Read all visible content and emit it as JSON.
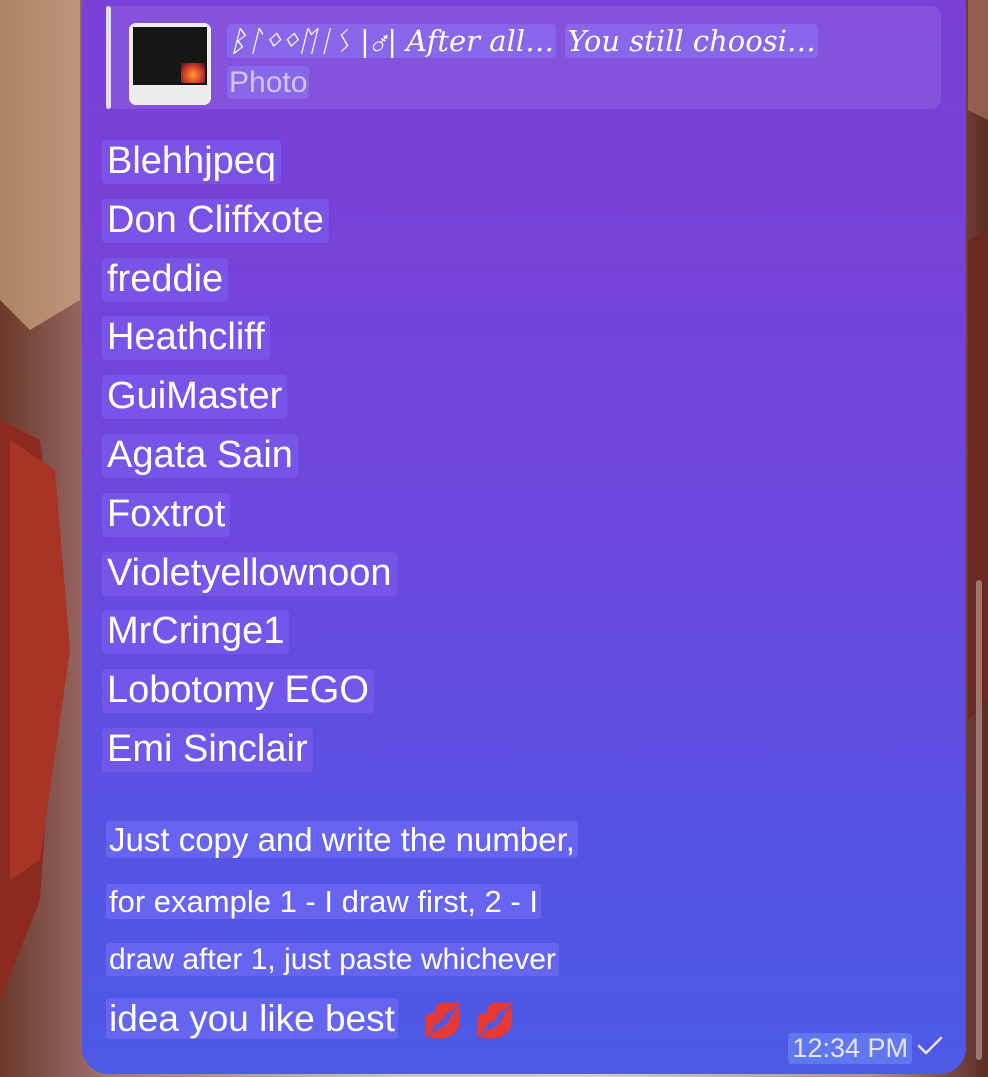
{
  "reply": {
    "name_label": "ᛒᛚᛜᛜᛖᛁᛊ |⚦| After all…",
    "name_quote": "You still choosi…",
    "subtitle": "Photo"
  },
  "names": [
    "Blehhjpeq",
    "Don Cliffxote",
    "freddie",
    "Heathcliff",
    "GuiMaster",
    "Agata Sain",
    "Foxtrot",
    "Violetyellownoon",
    "MrCringe1",
    "Lobotomy EGO",
    "Emi Sinclair"
  ],
  "message": {
    "line1": "Just copy and write the number,",
    "line2": "for example 1 - I draw first, 2 - I",
    "line3": "draw after 1, just paste whichever",
    "line4": "idea you like best",
    "emoji": "💋 💋"
  },
  "meta": {
    "time": "12:34 PM",
    "status_icon": "single-check-icon"
  },
  "colors": {
    "bubble_top": "#7a40d8",
    "bubble_bottom": "#4c5ae6",
    "text": "#ffffff"
  }
}
